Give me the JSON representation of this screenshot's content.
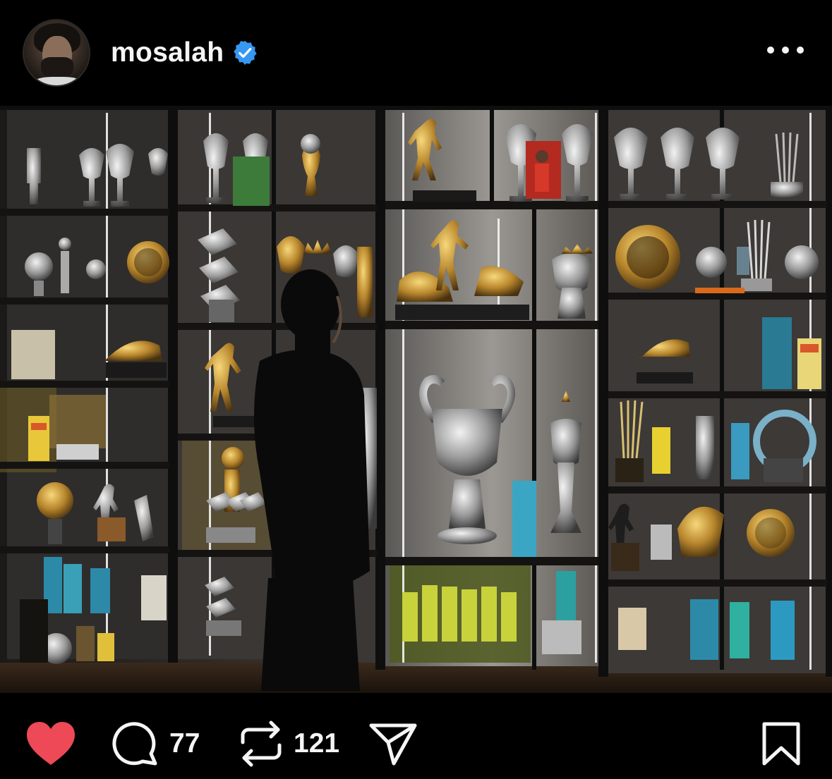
{
  "header": {
    "username": "mosalah",
    "verified_icon": "verified-badge-icon",
    "more_icon": "more-options-icon"
  },
  "post": {
    "image_icon": "trophy-cabinet-photo"
  },
  "actions": {
    "like": {
      "icon": "heart-icon",
      "liked": true,
      "color": "#ed4956"
    },
    "comment": {
      "icon": "comment-icon",
      "count": "77"
    },
    "repost": {
      "icon": "repost-icon",
      "count": "121"
    },
    "share": {
      "icon": "send-icon"
    },
    "save": {
      "icon": "bookmark-icon"
    }
  },
  "colors": {
    "background": "#000000",
    "text": "#f5f5f5",
    "verified": "#3897f0",
    "like": "#ed4956"
  }
}
